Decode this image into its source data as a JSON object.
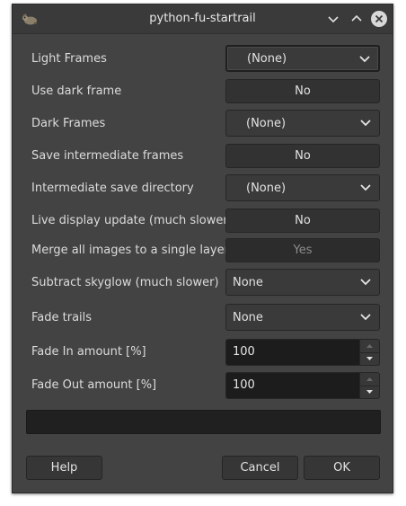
{
  "window": {
    "title": "python-fu-startrail",
    "icon": "gimp-wilber-icon",
    "controls": [
      "minimize-icon",
      "maximize-icon",
      "close-icon"
    ]
  },
  "fields": {
    "light_frames": {
      "label": "Light Frames",
      "value": "(None)"
    },
    "use_dark_frame": {
      "label": "Use dark frame",
      "value": "No"
    },
    "dark_frames": {
      "label": "Dark Frames",
      "value": "(None)"
    },
    "save_intermediate": {
      "label": "Save intermediate frames",
      "value": "No"
    },
    "intermediate_dir": {
      "label": "Intermediate save directory",
      "value": "(None)"
    },
    "live_display": {
      "label": "Live display update (much slower)",
      "value": "No"
    },
    "merge_single_layer": {
      "label": "Merge all images to a single layer",
      "value": "Yes"
    },
    "subtract_skyglow": {
      "label": "Subtract skyglow (much slower)",
      "value": "None"
    },
    "fade_trails": {
      "label": "Fade trails",
      "value": "None"
    },
    "fade_in": {
      "label": "Fade In amount [%]",
      "value": "100"
    },
    "fade_out": {
      "label": "Fade Out amount [%]",
      "value": "100"
    }
  },
  "progress": {
    "text": ""
  },
  "buttons": {
    "help": "Help",
    "cancel": "Cancel",
    "ok": "OK"
  },
  "colors": {
    "window_bg": "#434343",
    "field_bg": "#3a3a3a",
    "entry_bg": "#1c1c1c",
    "text": "#dcdcdc",
    "close_button": "#d8d8d8"
  }
}
